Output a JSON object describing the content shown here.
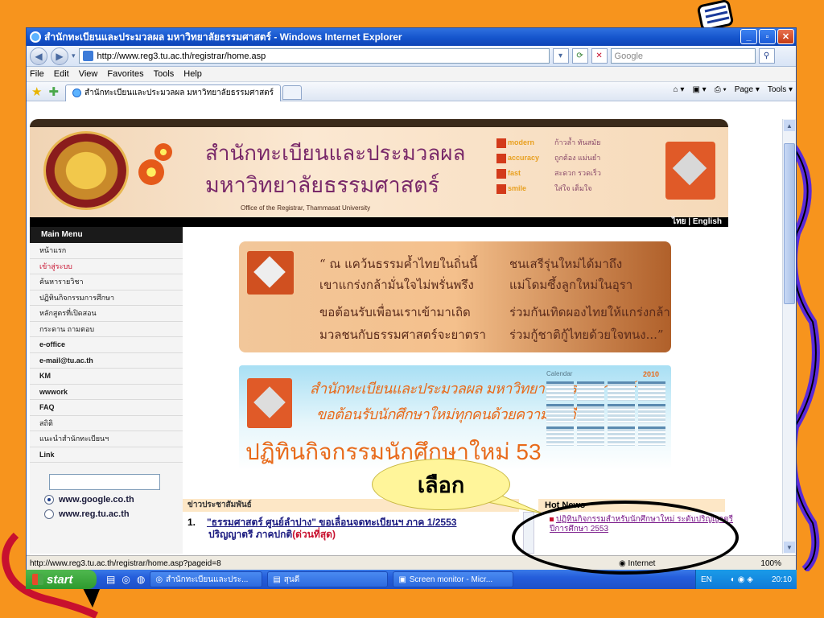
{
  "window": {
    "title": "สำนักทะเบียนและประมวลผล มหาวิทยาลัยธรรมศาสตร์ - Windows Internet Explorer",
    "min": "_",
    "max": "▫",
    "close": "✕"
  },
  "address": {
    "url": "http://www.reg3.tu.ac.th/registrar/home.asp",
    "search_placeholder": "Google"
  },
  "menu": [
    "File",
    "Edit",
    "View",
    "Favorites",
    "Tools",
    "Help"
  ],
  "tab": {
    "label": "สำนักทะเบียนและประมวลผล มหาวิทยาลัยธรรมศาสตร์"
  },
  "commandbar": {
    "page": "Page ▾",
    "tools": "Tools ▾"
  },
  "banner": {
    "title_th_1": "สำนักทะเบียนและประมวลผล",
    "title_th_2": "มหาวิทยาลัยธรรมศาสตร์",
    "title_en": "Office of the Registrar, Thammasat University",
    "motto": [
      {
        "lead": "modern",
        "text": "ก้าวล้ำ ทันสมัย"
      },
      {
        "lead": "accuracy",
        "text": "ถูกต้อง แม่นยำ"
      },
      {
        "lead": "fast",
        "text": "สะดวก รวดเร็ว"
      },
      {
        "lead": "smile",
        "text": "ใส่ใจ เต็มใจ"
      }
    ],
    "lang": "ไทย | English"
  },
  "leftmenu": {
    "heading": "Main Menu",
    "items": [
      "หน้าแรก",
      "เข้าสู่ระบบ",
      "ค้นหารายวิชา",
      "ปฏิทินกิจกรรมการศึกษา",
      "หลักสูตรที่เปิดสอน",
      "กระดาน ถามตอบ",
      "e-office",
      "e-mail@tu.ac.th",
      "KM",
      "wwwork",
      "FAQ",
      "สถิติ",
      "แนะนำสำนักทะเบียนฯ",
      "Link"
    ],
    "radios": [
      "www.google.co.th",
      "www.reg.tu.ac.th"
    ]
  },
  "poem": {
    "lines": [
      "“ ณ  แคว้นธรรมค้ำไทยในถิ่นนี้",
      "เขาแกร่งกล้ามั่นใจไม่พรั่นพรึง",
      "ขอต้อนรับเพื่อนเราเข้ามาเถิด",
      "มวลชนกับธรรมศาสตร์จะยาตรา",
      "ชนเสรีรุ่นใหม่ได้มาถึง",
      "แม่โดมซึ้งลูกใหม่ในอุรา",
      "ร่วมกันเทิดผองไทยให้แกร่งกล้า",
      "ร่วมกู้ชาติกู้ไทยด้วยใจทนง...”"
    ]
  },
  "calbanner": {
    "line1": "สำนักทะเบียนและประมวลผล มหาวิทยาลัยธรรมศาสตร์",
    "line2": "ขอต้อนรับนักศึกษาใหม่ทุกคนด้วยความยินดียิ่ง",
    "line3": "ปฏิทินกิจกรรมนักศึกษาใหม่ 53",
    "cal_label": "Calendar",
    "cal_year": "2010"
  },
  "news": {
    "heading": "ข่าวประชาสัมพันธ์",
    "item_number": "1.",
    "item_link": "\"ธรรมศาสตร์ ศูนย์ลำปาง\" ขอเลื่อนจดทะเบียนฯ ภาค 1/2553",
    "item_line2": "ปริญญาตรี ภาคปกติ",
    "item_urgent": "(ด่วนที่สุด)"
  },
  "hotnews": {
    "heading": "Hot News",
    "item": "ปฏิทินกิจกรรมสำหรับนักศึกษาใหม่ ระดับปริญญาตรี ปีการศึกษา 2553"
  },
  "annotation": {
    "callout": "เลือก"
  },
  "status": {
    "url": "http://www.reg3.tu.ac.th/registrar/home.asp?pageid=8",
    "zone": "Internet",
    "zoom": "100%"
  },
  "taskbar": {
    "start": "start",
    "tasks": [
      "สำนักทะเบียนและประ...",
      "สุนดี",
      "Screen monitor - Micr..."
    ],
    "lang": "EN",
    "clock": "20:10"
  },
  "colors": {
    "slide_bg": "#F7941D",
    "xp_blue": "#245DDB",
    "accent_red": "#C8102E"
  }
}
